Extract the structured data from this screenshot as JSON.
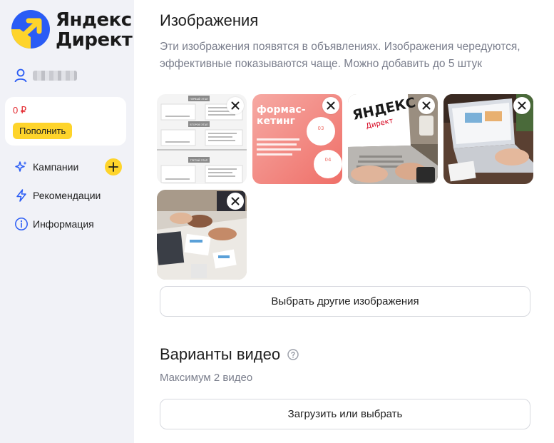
{
  "brand": {
    "name_line1": "Яндекс",
    "name_line2": "Директ",
    "accent": "#fed42b",
    "logo_blue": "#2a5cf5"
  },
  "account": {
    "balance": "0 ₽",
    "topup_label": "Пополнить"
  },
  "nav": {
    "campaigns": "Кампании",
    "recommendations": "Рекомендации",
    "info": "Информация"
  },
  "images_section": {
    "title": "Изображения",
    "description": "Эти изображения появятся в объявлениях. Изображения чередуются, эффективные показываются чаще. Можно добавить до 5 штук",
    "items": [
      {
        "icon": "infographic-image",
        "caption_lines": [
          "ПЕРВЫЙ ЭТАП",
          "ВТОРОЙ ЭТАП",
          "ТРЕТИЙ ЭТАП"
        ]
      },
      {
        "icon": "marketing-slide-image",
        "caption_lines": [
          "формаc-",
          "кетинг",
          "03",
          "04"
        ]
      },
      {
        "icon": "laptop-yandex-image",
        "caption_lines": [
          "ЯНДЕКС",
          "Директ"
        ]
      },
      {
        "icon": "laptop-desk-image"
      },
      {
        "icon": "team-meeting-image"
      }
    ],
    "choose_other_label": "Выбрать другие изображения"
  },
  "video_section": {
    "title": "Варианты видео",
    "subtitle": "Максимум 2 видео",
    "upload_label": "Загрузить или выбрать"
  }
}
